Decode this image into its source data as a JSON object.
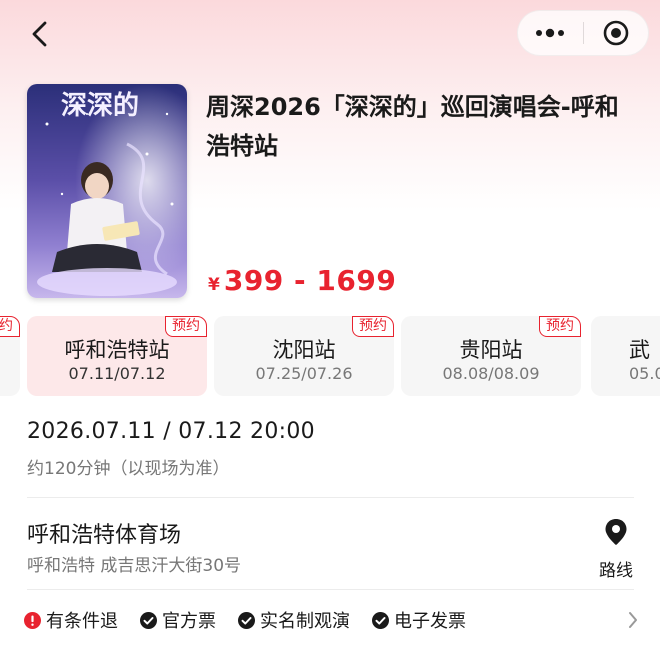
{
  "header": {
    "back_icon": "chevron-left-icon",
    "more_icon": "more-dots-icon",
    "target_icon": "target-icon"
  },
  "event": {
    "title": "周深2026「深深的」巡回演唱会-呼和浩特站",
    "poster_title": "深深的",
    "price_currency": "¥",
    "price_range": "399 - 1699"
  },
  "sessions": [
    {
      "name": "",
      "date": "",
      "badge": "约"
    },
    {
      "name": "呼和浩特站",
      "date": "07.11/07.12",
      "badge": "预约",
      "active": true
    },
    {
      "name": "沈阳站",
      "date": "07.25/07.26",
      "badge": "预约"
    },
    {
      "name": "贵阳站",
      "date": "08.08/08.09",
      "badge": "预约"
    },
    {
      "name": "武",
      "date": "05.0",
      "badge": ""
    }
  ],
  "schedule": {
    "datetime": "2026.07.11 / 07.12 20:00",
    "duration": "约120分钟（以现场为准）"
  },
  "venue": {
    "name": "呼和浩特体育场",
    "address": "呼和浩特 成吉思汗大街30号",
    "route_label": "路线",
    "route_icon": "location-pin-icon"
  },
  "policies": [
    {
      "label": "有条件退",
      "icon": "alert-circle-icon",
      "color": "#e8232f"
    },
    {
      "label": "官方票",
      "icon": "check-circle-icon",
      "color": "#1a1a1a"
    },
    {
      "label": "实名制观演",
      "icon": "check-circle-icon",
      "color": "#1a1a1a"
    },
    {
      "label": "电子发票",
      "icon": "check-circle-icon",
      "color": "#1a1a1a"
    }
  ],
  "colors": {
    "accent": "#e8232f",
    "active_session_bg": "#fde8e9",
    "session_bg": "#f6f6f6"
  }
}
